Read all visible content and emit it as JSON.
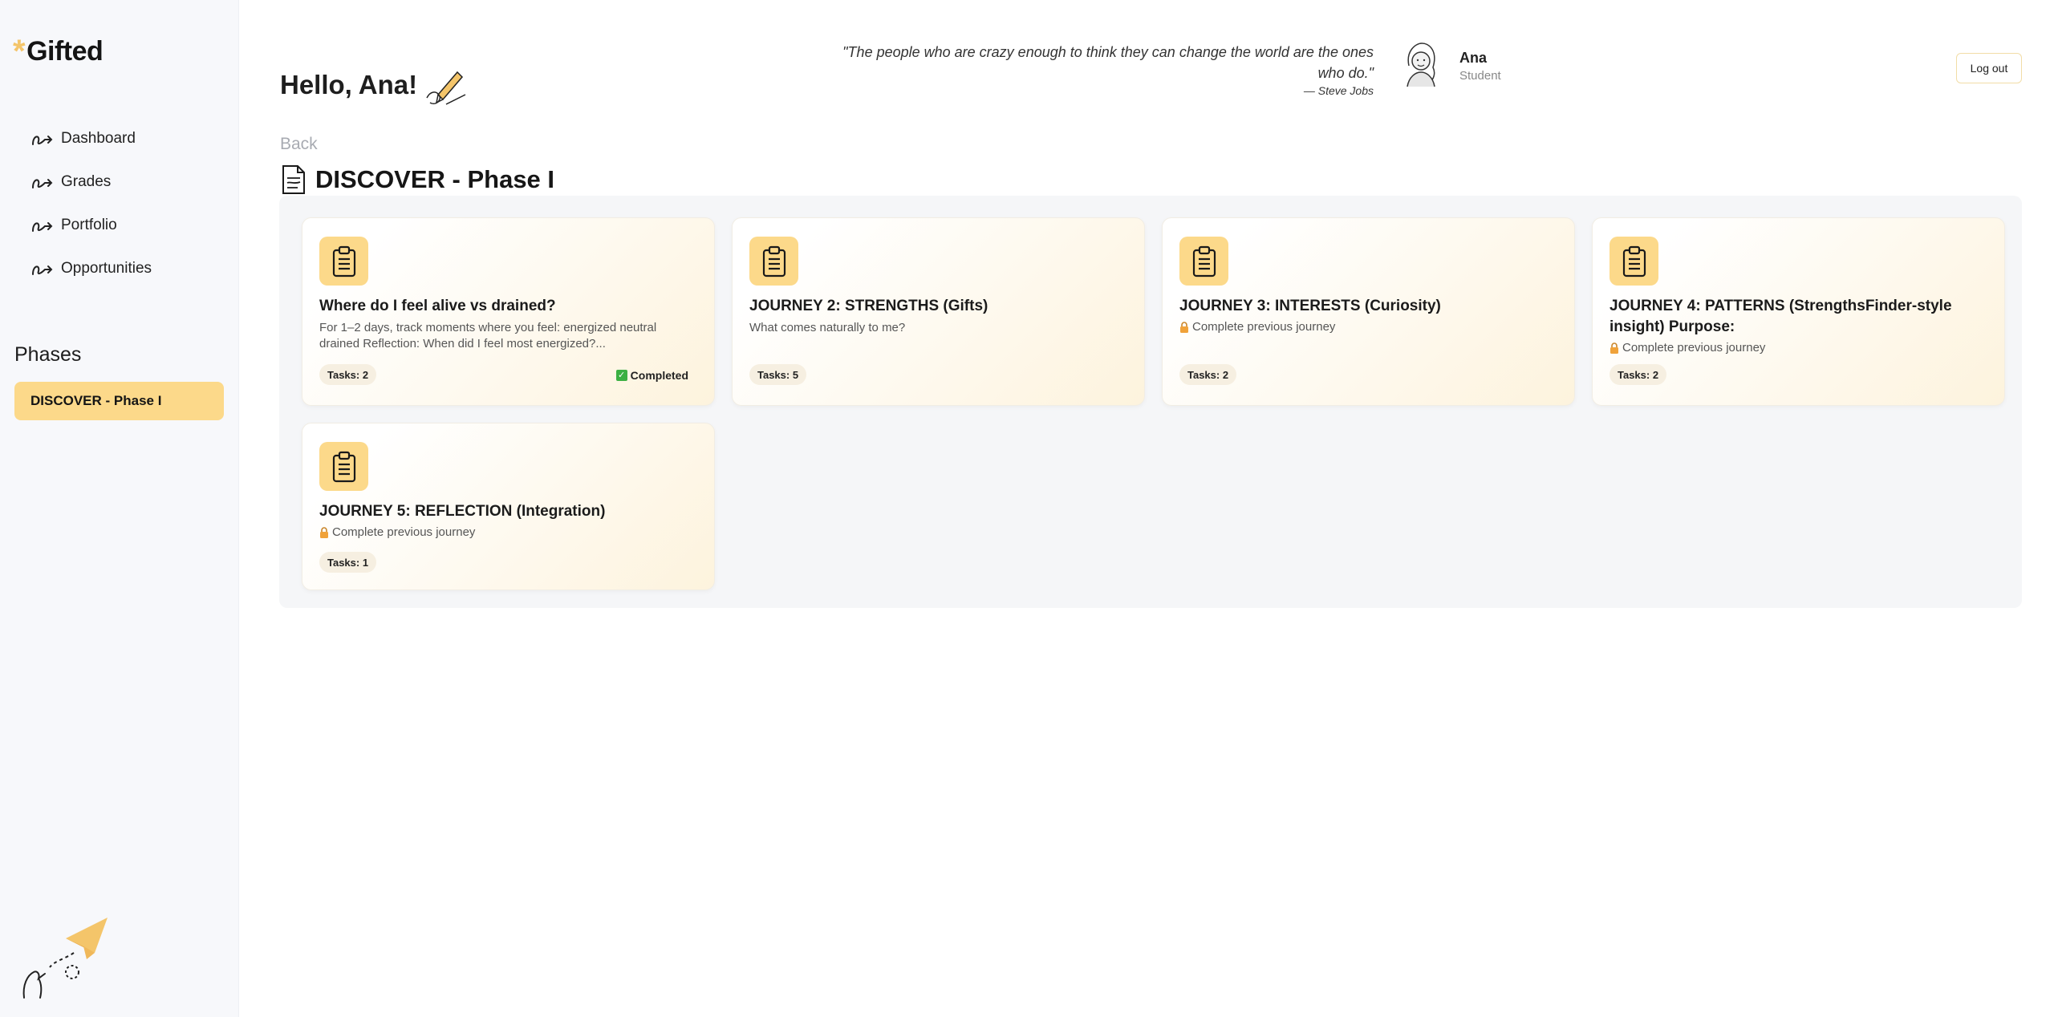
{
  "app": {
    "logo_mark": "*",
    "logo_text": "Gifted"
  },
  "sidebar": {
    "items": [
      {
        "label": "Dashboard",
        "icon": "squiggle-arrow-icon"
      },
      {
        "label": "Grades",
        "icon": "squiggle-arrow-icon"
      },
      {
        "label": "Portfolio",
        "icon": "squiggle-arrow-icon"
      },
      {
        "label": "Opportunities",
        "icon": "squiggle-arrow-icon"
      }
    ],
    "phases_title": "Phases",
    "active_phase": "DISCOVER - Phase I"
  },
  "header": {
    "greeting": "Hello, Ana!",
    "quote": "\"The people who are crazy enough to think they can change the world are the ones who do.\"",
    "quote_author": "— Steve Jobs",
    "user_name": "Ana",
    "user_role": "Student",
    "logout_label": "Log out"
  },
  "main": {
    "back_label": "Back",
    "title": "DISCOVER - Phase I",
    "cards": [
      {
        "title": "Where do I feel alive vs drained?",
        "description": "For 1–2 days, track moments where you feel: energized neutral drained Reflection: When did I feel most energized?...",
        "tasks": "Tasks: 2",
        "status": "Completed"
      },
      {
        "title": "JOURNEY 2: STRENGTHS (Gifts)",
        "description": "What comes naturally to me?",
        "tasks": "Tasks: 5"
      },
      {
        "title": "JOURNEY 3: INTERESTS (Curiosity)",
        "locked_text": "Complete previous journey",
        "tasks": "Tasks: 2"
      },
      {
        "title": "JOURNEY 4: PATTERNS (StrengthsFinder-style insight) Purpose:",
        "locked_text": "Complete previous journey",
        "tasks": "Tasks: 2"
      },
      {
        "title": "JOURNEY 5: REFLECTION (Integration)",
        "locked_text": "Complete previous journey",
        "tasks": "Tasks: 1"
      }
    ]
  },
  "colors": {
    "accent": "#fcd98a",
    "brand_star": "#f4c56a",
    "completed": "#3cb043",
    "lock": "#f0a23a"
  }
}
